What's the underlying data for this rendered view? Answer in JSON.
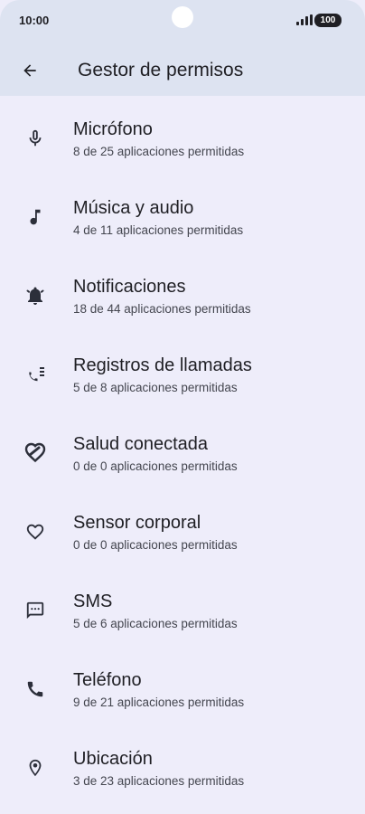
{
  "status_bar": {
    "time": "10:00",
    "battery": "100"
  },
  "app_bar": {
    "title": "Gestor de permisos",
    "back_icon": "arrow-back-icon"
  },
  "permissions": [
    {
      "label": "Micrófono",
      "summary": "8 de 25 aplicaciones permitidas",
      "icon": "microphone-icon"
    },
    {
      "label": "Música y audio",
      "summary": "4 de 11 aplicaciones permitidas",
      "icon": "music-note-icon"
    },
    {
      "label": "Notificaciones",
      "summary": "18 de 44 aplicaciones permitidas",
      "icon": "notification-bell-icon"
    },
    {
      "label": "Registros de llamadas",
      "summary": "5 de 8 aplicaciones permitidas",
      "icon": "call-log-icon"
    },
    {
      "label": "Salud conectada",
      "summary": "0 de 0 aplicaciones permitidas",
      "icon": "health-connect-icon"
    },
    {
      "label": "Sensor corporal",
      "summary": "0 de 0 aplicaciones permitidas",
      "icon": "heart-icon"
    },
    {
      "label": "SMS",
      "summary": "5 de 6 aplicaciones permitidas",
      "icon": "sms-icon"
    },
    {
      "label": "Teléfono",
      "summary": "9 de 21 aplicaciones permitidas",
      "icon": "phone-icon"
    },
    {
      "label": "Ubicación",
      "summary": "3 de 23 aplicaciones permitidas",
      "icon": "location-pin-icon"
    }
  ]
}
